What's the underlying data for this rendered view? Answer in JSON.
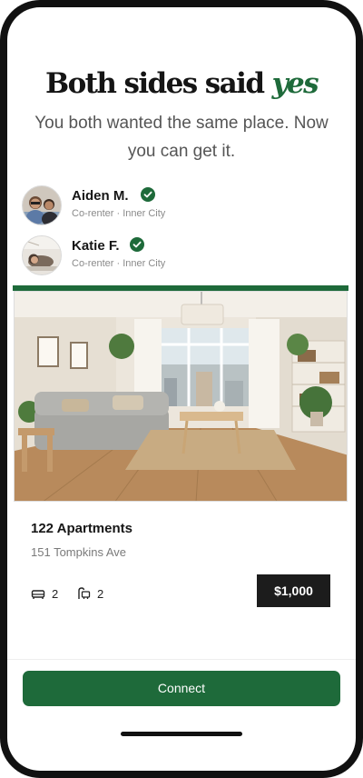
{
  "headline": {
    "main": "Both sides said",
    "accent": "yes"
  },
  "subtitle": "You both wanted the same place. Now you can get it.",
  "people": [
    {
      "name": "Aiden M.",
      "subtitle": "Co-renter · Inner City",
      "verified": true
    },
    {
      "name": "Katie F.",
      "subtitle": "Co-renter · Inner City",
      "verified": true
    }
  ],
  "listing": {
    "name": "122 Apartments",
    "address": "151 Tompkins Ave",
    "beds": "2",
    "baths": "2",
    "price": "$1,000"
  },
  "actions": {
    "connect_label": "Connect"
  },
  "colors": {
    "accent": "#1e6a3a",
    "price_bg": "#1c1c1c",
    "text": "#161616"
  },
  "icons": {
    "verified": "check-badge-icon",
    "beds": "bed-icon",
    "baths": "bath-icon"
  }
}
